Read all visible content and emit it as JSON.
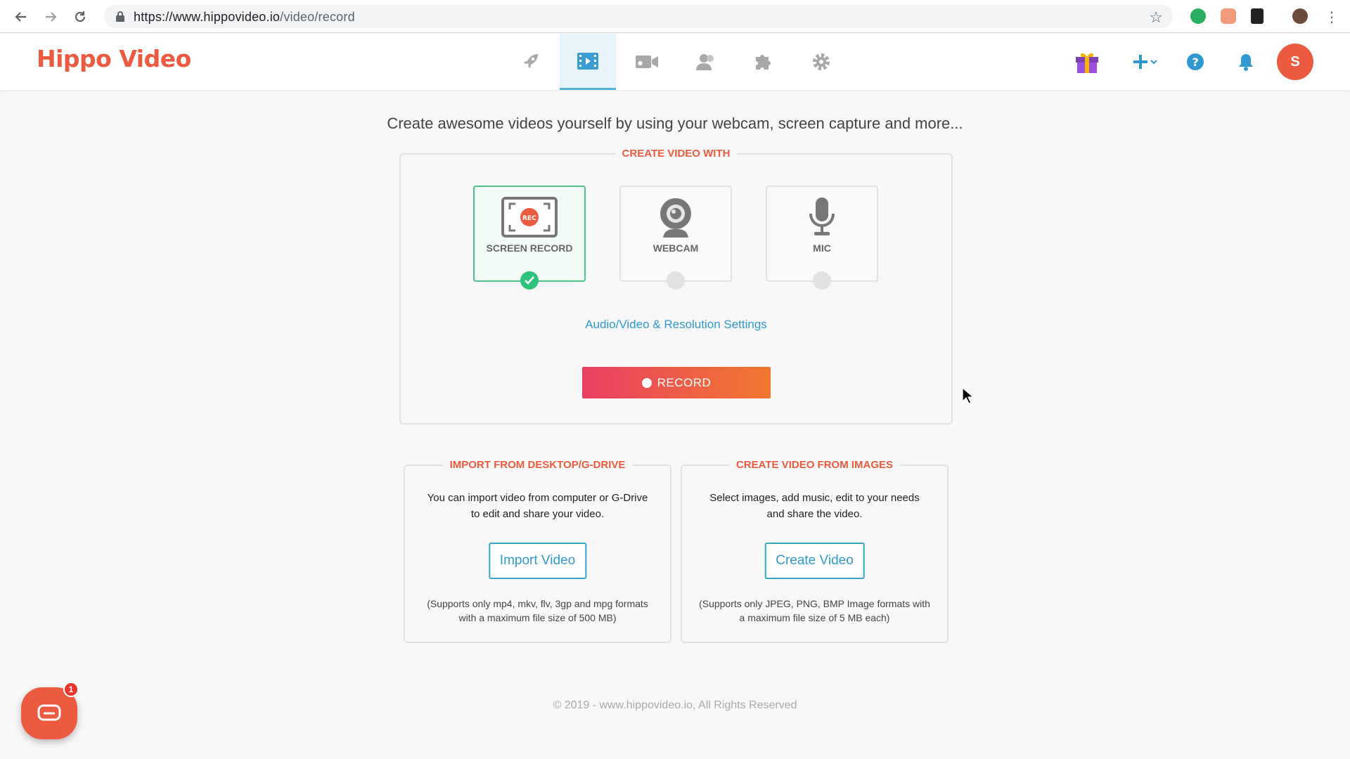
{
  "browser": {
    "url_host": "https://www.hippovideo.io",
    "url_path": "/video/record",
    "back_icon": "arrow-left",
    "forward_icon": "arrow-right",
    "reload_icon": "reload",
    "bookmark_icon": "star-outline"
  },
  "header": {
    "logo": "Hippo Video",
    "nav_icons": [
      "rocket-icon",
      "video-library-icon",
      "record-video-icon",
      "contacts-icon",
      "integrations-icon",
      "settings-gear-icon"
    ],
    "active_nav": "video-library-icon",
    "avatar_initial": "S",
    "colors": {
      "brand": "#ec5b40",
      "active_tab_bg": "#e7f4fa",
      "accent_blue": "#2f9ad0"
    }
  },
  "main": {
    "tagline": "Create awesome videos yourself by using your webcam, screen capture and more...",
    "create_with": {
      "title": "CREATE VIDEO WITH",
      "options": [
        {
          "label": "SCREEN RECORD",
          "selected": true
        },
        {
          "label": "WEBCAM",
          "selected": false
        },
        {
          "label": "MIC",
          "selected": false
        }
      ],
      "screen_icon_text": "REC",
      "settings_link": "Audio/Video & Resolution Settings",
      "record_button": "RECORD"
    },
    "import_card": {
      "title": "IMPORT FROM DESKTOP/G-DRIVE",
      "description": "You can import video from computer or G-Drive to edit and share your video.",
      "button": "Import Video",
      "note": "(Supports only mp4, mkv, flv, 3gp and mpg formats with a maximum file size of 500 MB)"
    },
    "images_card": {
      "title": "CREATE VIDEO FROM IMAGES",
      "description": "Select images, add music, edit to your needs and share the video.",
      "button": "Create Video",
      "note": "(Supports only JPEG, PNG, BMP Image formats with a maximum file size of 5 MB each)"
    }
  },
  "footer": {
    "copyright": "© 2019 - www.hippovideo.io, All Rights Reserved"
  },
  "chat": {
    "badge_count": "1"
  }
}
